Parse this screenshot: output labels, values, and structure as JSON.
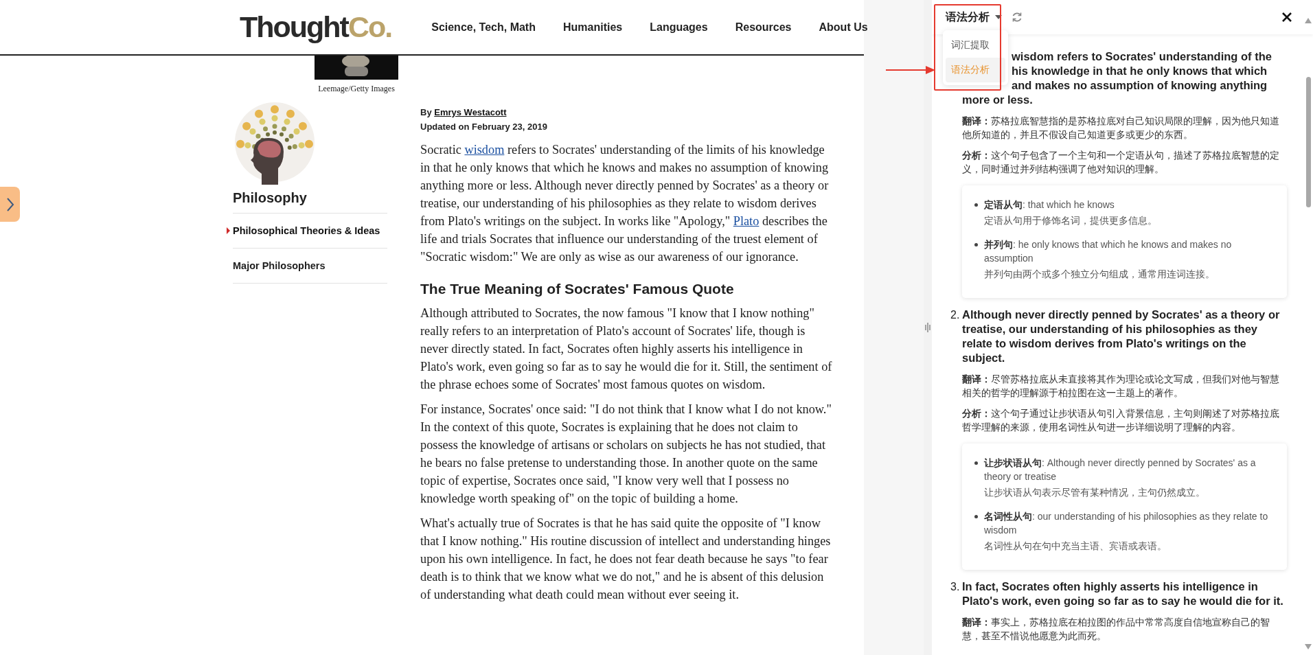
{
  "header": {
    "logo": [
      {
        "kind": "main",
        "text": "Thought"
      },
      {
        "kind": "accent",
        "text": "Co."
      }
    ],
    "nav": [
      "Science, Tech, Math",
      "Humanities",
      "Languages",
      "Resources",
      "About Us"
    ]
  },
  "figure": {
    "caption": "Leemage/Getty Images"
  },
  "sidebar": {
    "title": "Philosophy",
    "items": [
      {
        "label": "Philosophical Theories & Ideas",
        "selected": true
      },
      {
        "label": "Major Philosophers",
        "selected": false
      }
    ]
  },
  "article": {
    "byline": {
      "prefix": "By ",
      "author": "Emrys Westacott"
    },
    "updated": "Updated on February 23, 2019",
    "blocks": [
      {
        "kind": "paragraph",
        "parts": [
          {
            "kind": "text",
            "text": "Socratic "
          },
          {
            "kind": "link",
            "text": "wisdom"
          },
          {
            "kind": "text",
            "text": " refers to Socrates' understanding of the limits of his knowledge in that he only knows that which he knows and makes no assumption of knowing anything more or less. Although never directly penned by Socrates' as a theory or treatise, our understanding of his philosophies as they relate to wisdom derives from Plato's writings on the subject. In works like \"Apology,\" "
          },
          {
            "kind": "link",
            "text": "Plato"
          },
          {
            "kind": "text",
            "text": " describes the life and trials Socrates that influence our understanding of the truest element of \"Socratic wisdom:\" We are only as wise as our awareness of our ignorance."
          }
        ]
      },
      {
        "kind": "heading",
        "text": "The True Meaning of Socrates' Famous Quote"
      },
      {
        "kind": "paragraph",
        "parts": [
          {
            "kind": "text",
            "text": "Although attributed to Socrates, the now famous \"I know that I know nothing\" really refers to an interpretation of Plato's account of Socrates' life, though is never directly stated. In fact, Socrates often highly asserts his intelligence in Plato's work, even going so far as to say he would die for it. Still, the sentiment of the phrase echoes some of Socrates' most famous quotes on wisdom."
          }
        ]
      },
      {
        "kind": "paragraph",
        "parts": [
          {
            "kind": "text",
            "text": "For instance, Socrates' once said: \"I do not think that I know what I do not know.\" In the context of this quote, Socrates is explaining that he does not claim to possess the knowledge of artisans or scholars on subjects he has not studied, that he bears no false pretense to understanding those. In another quote on the same topic of expertise, Socrates once said, \"I know very well that I possess no knowledge worth speaking of\" on the topic of building a home."
          }
        ]
      },
      {
        "kind": "paragraph",
        "parts": [
          {
            "kind": "text",
            "text": "What's actually true of Socrates is that he has said quite the opposite of \"I know that I know nothing.\" His routine discussion of intellect and understanding hinges upon his own intelligence. In fact, he does not fear death because he says \"to fear death is to think that we know what we do not,\" and he is absent of this delusion of understanding what death could mean without ever seeing it."
          }
        ]
      }
    ]
  },
  "panel": {
    "mode": "语法分析",
    "menu": [
      {
        "label": "词汇提取",
        "selected": false
      },
      {
        "label": "语法分析",
        "selected": true
      }
    ],
    "sentences": [
      {
        "lines": [
          {
            "kind": "covered",
            "text": "wisdom refers to Socrates' understanding of the"
          },
          {
            "kind": "covered",
            "text": "his knowledge in that he only knows that which"
          },
          {
            "kind": "covered",
            "text": "and makes no assumption of knowing anything"
          },
          {
            "kind": "full",
            "text": "more or less."
          }
        ],
        "translation": "**翻译：**苏格拉底智慧指的是苏格拉底对自己知识局限的理解，因为他只知道他所知道的，并且不假设自己知道更多或更少的东西。",
        "analysis": "**分析：**这个句子包含了一个主句和一个定语从句，描述了苏格拉底智慧的定义，同时通过并列结构强调了他对知识的理解。",
        "points": [
          {
            "text": "**定语从句**: that which he knows",
            "note": "定语从句用于修饰名词，提供更多信息。"
          },
          {
            "text": "**并列句**: he only knows that which he knows and makes no assumption",
            "note": "并列句由两个或多个独立分句组成，通常用连词连接。"
          }
        ]
      },
      {
        "number": "2.",
        "text": "Although never directly penned by Socrates' as a theory or treatise, our understanding of his philosophies as they relate to wisdom derives from Plato's writings on the subject.",
        "translation": "**翻译：**尽管苏格拉底从未直接将其作为理论或论文写成，但我们对他与智慧相关的哲学的理解源于柏拉图在这一主题上的著作。",
        "analysis": "**分析：**这个句子通过让步状语从句引入背景信息，主句则阐述了对苏格拉底哲学理解的来源，使用名词性从句进一步详细说明了理解的内容。",
        "points": [
          {
            "text": "**让步状语从句**: Although never directly penned by Socrates' as a theory or treatise",
            "note": "让步状语从句表示尽管有某种情况，主句仍然成立。"
          },
          {
            "text": "**名词性从句**: our understanding of his philosophies as they relate to wisdom",
            "note": "名词性从句在句中充当主语、宾语或表语。"
          }
        ]
      },
      {
        "number": "3.",
        "text": "In fact, Socrates often highly asserts his intelligence in Plato's work, even going so far as to say he would die for it.",
        "translation": "**翻译：**事实上，苏格拉底在柏拉图的作品中常常高度自信地宣称自己的智慧，甚至不惜说他愿意为此而死。"
      }
    ]
  }
}
